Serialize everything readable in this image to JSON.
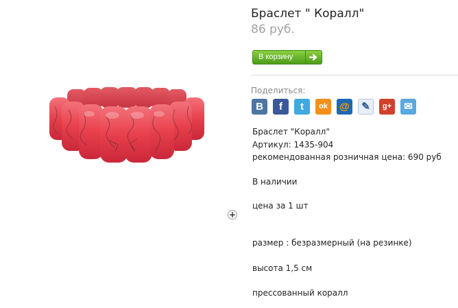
{
  "product": {
    "title": "Браслет \" Коралл\"",
    "price": "86 руб."
  },
  "cart": {
    "button_label": "В корзину",
    "arrow_icon": "arrow-right-icon"
  },
  "share": {
    "label": "Поделиться:",
    "icons": [
      {
        "name": "vkontakte-icon",
        "glyph": "B",
        "color": "#4d75a3"
      },
      {
        "name": "facebook-icon",
        "glyph": "f",
        "color": "#3b5998"
      },
      {
        "name": "twitter-icon",
        "glyph": "t",
        "color": "#3fa9e0"
      },
      {
        "name": "odnoklassniki-icon",
        "glyph": "ok",
        "color": "#f39019"
      },
      {
        "name": "mailru-icon",
        "glyph": "@",
        "color": "#1d68b3"
      },
      {
        "name": "livejournal-icon",
        "glyph": "✎",
        "color": "#e8eef6"
      },
      {
        "name": "googleplus-icon",
        "glyph": "g+",
        "color": "#d0412c"
      },
      {
        "name": "email-icon",
        "glyph": "✉",
        "color": "#5aa8e0"
      }
    ]
  },
  "description": {
    "name_line": "Браслет \"Коралл\"",
    "article": "Артикул: 1435-904",
    "recommended_price": "рекомендованная розничная цена: 690 руб",
    "availability": "В наличии",
    "price_per": "цена за 1 шт",
    "size": "размер : безразмерный (на резинке)",
    "height": "высота 1,5 см",
    "material": "прессованный коралл"
  },
  "image": {
    "subject": "red coral bracelet",
    "icon": "zoom-plus-icon"
  }
}
